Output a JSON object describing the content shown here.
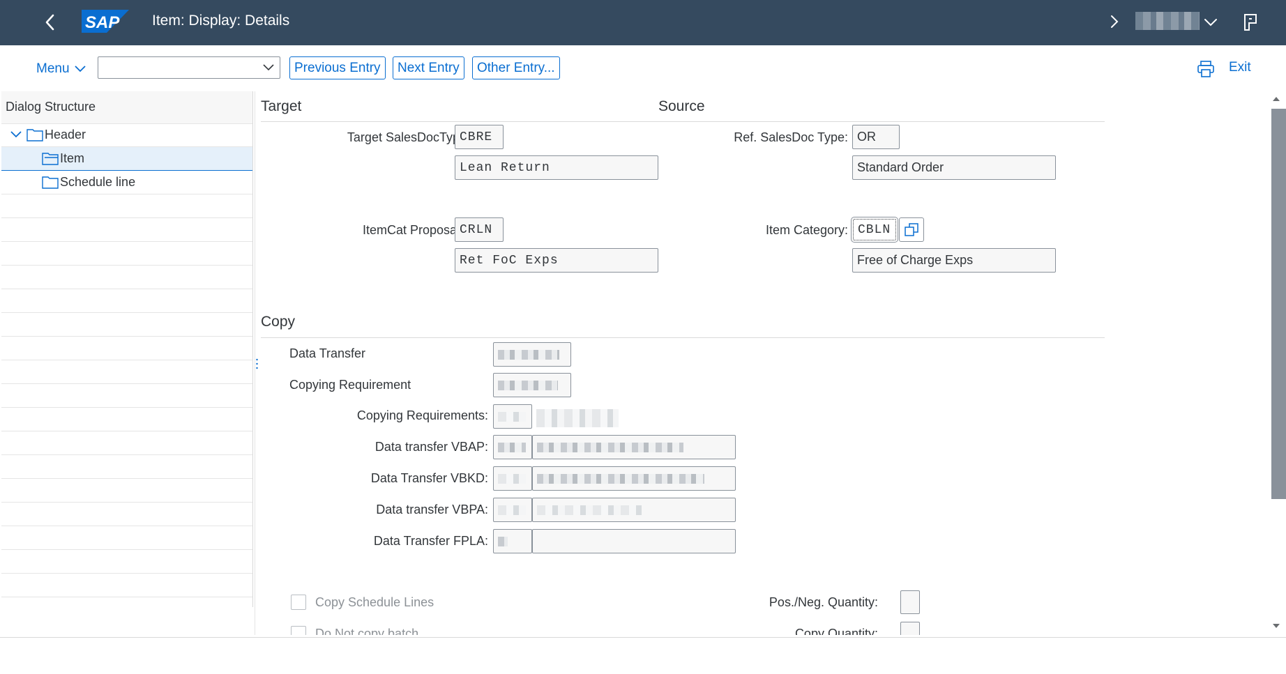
{
  "shell": {
    "title": "Item: Display: Details",
    "logo_text": "SAP",
    "brand_color": "#354a5f",
    "logo_color": "#0a6ed1"
  },
  "toolbar": {
    "menu_label": "Menu",
    "command_field_value": "",
    "previous_entry": "Previous Entry",
    "next_entry": "Next Entry",
    "other_entry": "Other Entry...",
    "exit_label": "Exit"
  },
  "tree": {
    "title": "Dialog Structure",
    "items": [
      {
        "label": "Header"
      },
      {
        "label": "Item",
        "selected": true
      },
      {
        "label": "Schedule line"
      }
    ]
  },
  "target_source": {
    "target_heading": "Target",
    "source_heading": "Source",
    "target_salesdoc_label": "Target SalesDocTyp:",
    "target_salesdoc_value": "CBRE",
    "target_salesdoc_desc": "Lean Return",
    "ref_salesdoc_label": "Ref. SalesDoc Type:",
    "ref_salesdoc_value": "OR",
    "ref_salesdoc_desc": "Standard Order",
    "itemcat_proposal_label": "ItemCat Proposal:",
    "itemcat_proposal_value": "CRLN",
    "itemcat_proposal_desc": "Ret FoC Exps",
    "item_category_label": "Item Category:",
    "item_category_value": "CBLN",
    "item_category_desc": "Free of Charge Exps"
  },
  "copy": {
    "heading": "Copy",
    "data_transfer_label": "Data Transfer",
    "copying_requirement_label": "Copying Requirement",
    "copying_requirements_label": "Copying Requirements:",
    "data_transfer_vbap_label": "Data transfer VBAP:",
    "data_transfer_vbkd_label": "Data Transfer VBKD:",
    "data_transfer_vbpa_label": "Data transfer VBPA:",
    "data_transfer_fpla_label": "Data Transfer FPLA:",
    "copy_schedule_lines_label": "Copy Schedule Lines",
    "do_not_copy_batch_label": "Do Not copy batch",
    "pos_neg_quantity_label": "Pos./Neg. Quantity:",
    "copy_quantity_label": "Copy Quantity:"
  }
}
